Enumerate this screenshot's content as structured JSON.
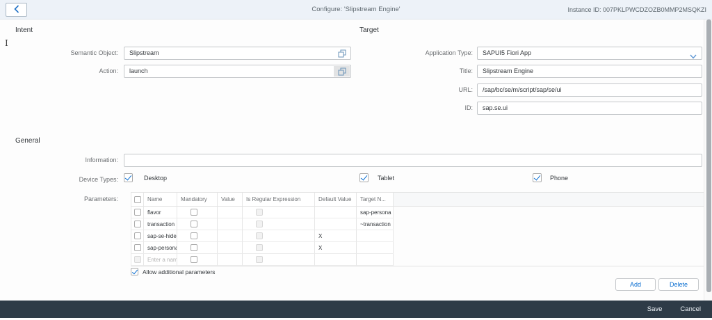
{
  "header": {
    "title": "Configure: 'Slipstream Engine'",
    "instance_id": "Instance ID: 007PKLPWCDZOZB0MMP2MSQKZI"
  },
  "intent": {
    "section_title": "Intent",
    "semantic_object": {
      "label": "Semantic Object:",
      "value": "Slipstream"
    },
    "action": {
      "label": "Action:",
      "value": "launch"
    }
  },
  "target": {
    "section_title": "Target",
    "application_type": {
      "label": "Application Type:",
      "value": "SAPUI5 Fiori App"
    },
    "title_field": {
      "label": "Title:",
      "value": "Slipstream Engine"
    },
    "url": {
      "label": "URL:",
      "value": "/sap/bc/se/m/script/sap/se/ui"
    },
    "id": {
      "label": "ID:",
      "value": "sap.se.ui"
    }
  },
  "general": {
    "section_title": "General",
    "information": {
      "label": "Information:",
      "value": ""
    },
    "device_types": {
      "label": "Device Types:",
      "options": [
        {
          "label": "Desktop",
          "checked": true
        },
        {
          "label": "Tablet",
          "checked": true
        },
        {
          "label": "Phone",
          "checked": true
        }
      ]
    },
    "parameters": {
      "label": "Parameters:",
      "columns": [
        "Name",
        "Mandatory",
        "Value",
        "Is Regular Expression",
        "Default Value",
        "Target N..."
      ],
      "rows": [
        {
          "name": "flavor",
          "mandatory": false,
          "value": "",
          "is_regex": false,
          "default_value": "",
          "target_name": "sap-persona"
        },
        {
          "name": "transaction",
          "mandatory": false,
          "value": "",
          "is_regex": false,
          "default_value": "",
          "target_name": "~transaction"
        },
        {
          "name": "sap-se-hide-",
          "mandatory": false,
          "value": "",
          "is_regex": false,
          "default_value": "X",
          "target_name": ""
        },
        {
          "name": "sap-persona",
          "mandatory": false,
          "value": "",
          "is_regex": false,
          "default_value": "X",
          "target_name": ""
        },
        {
          "name": "",
          "name_placeholder": "Enter a nam",
          "mandatory": false,
          "value": "",
          "is_regex": false,
          "default_value": "",
          "target_name": ""
        }
      ],
      "allow_additional": {
        "label": "Allow additional parameters",
        "checked": true
      },
      "add_button": "Add",
      "delete_button": "Delete"
    }
  },
  "footer": {
    "save": "Save",
    "cancel": "Cancel"
  },
  "colors": {
    "accent_blue": "#0a6ed1",
    "header_bg": "#edf2f8",
    "footer_bg": "#2e3b47",
    "value_help_icon": "#6a93b8"
  }
}
